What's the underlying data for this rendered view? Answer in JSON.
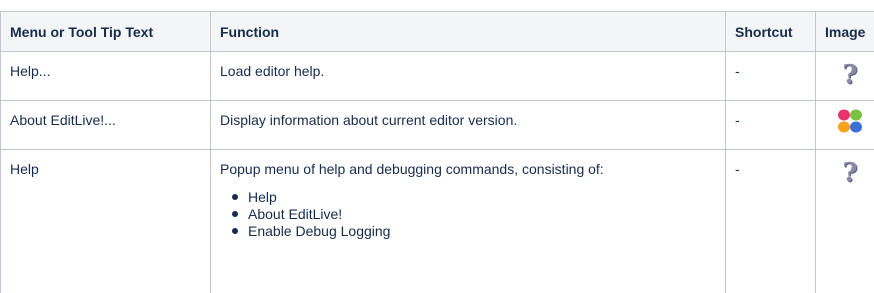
{
  "table": {
    "headers": [
      "Menu or Tool Tip Text",
      "Function",
      "Shortcut",
      "Image"
    ],
    "rows": [
      {
        "menu_text": "Help...",
        "function": "Load editor help.",
        "shortcut": "-",
        "image_icon": "help-question-icon"
      },
      {
        "menu_text": "About EditLive!...",
        "function": "Display information about current editor version.",
        "shortcut": "-",
        "image_icon": "editlive-about-icon"
      },
      {
        "menu_text": "Help",
        "function": "Popup menu of help and debugging commands, consisting of:",
        "function_items": [
          "Help",
          "About EditLive!",
          "Enable Debug Logging"
        ],
        "shortcut": "-",
        "image_icon": "help-question-icon"
      }
    ]
  },
  "colors": {
    "header_bg": "#f4f5f7",
    "border": "#c1c7d0",
    "text": "#172b4d",
    "about_icon_colors": [
      "#e8336b",
      "#7ac143",
      "#f6a21a",
      "#3c6fd8"
    ]
  }
}
